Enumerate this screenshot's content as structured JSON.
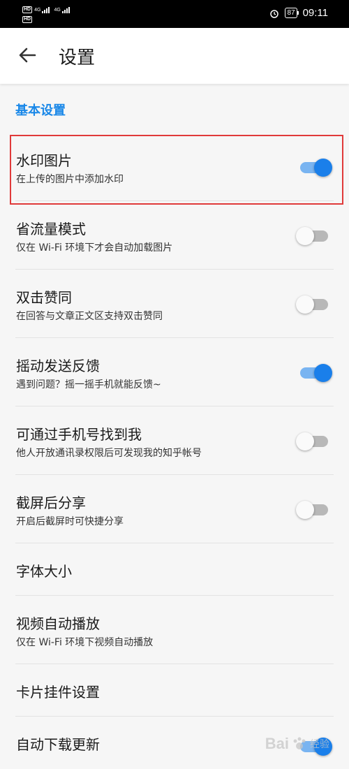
{
  "status_bar": {
    "hd_label": "HD",
    "net_top": "4G",
    "net_bottom": "4G",
    "battery": "87",
    "time": "09:11"
  },
  "app_bar": {
    "title": "设置"
  },
  "section": {
    "title": "基本设置"
  },
  "rows": [
    {
      "title": "水印图片",
      "subtitle": "在上传的图片中添加水印",
      "toggle": true
    },
    {
      "title": "省流量模式",
      "subtitle": "仅在 Wi-Fi 环境下才会自动加载图片",
      "toggle": false
    },
    {
      "title": "双击赞同",
      "subtitle": "在回答与文章正文区支持双击赞同",
      "toggle": false
    },
    {
      "title": "摇动发送反馈",
      "subtitle": "遇到问题？摇一摇手机就能反馈~",
      "toggle": true
    },
    {
      "title": "可通过手机号找到我",
      "subtitle": "他人开放通讯录权限后可发现我的知乎帐号",
      "toggle": false
    },
    {
      "title": "截屏后分享",
      "subtitle": "开启后截屏时可快捷分享",
      "toggle": false
    },
    {
      "title": "字体大小"
    },
    {
      "title": "视频自动播放",
      "subtitle": "仅在 Wi-Fi 环境下视频自动播放"
    },
    {
      "title": "卡片挂件设置"
    },
    {
      "title": "自动下载更新",
      "toggle": true
    }
  ],
  "watermark": {
    "brand": "Bai",
    "suffix": "经验"
  },
  "colors": {
    "accent": "#1a7fea",
    "highlight": "#e03a3a"
  }
}
